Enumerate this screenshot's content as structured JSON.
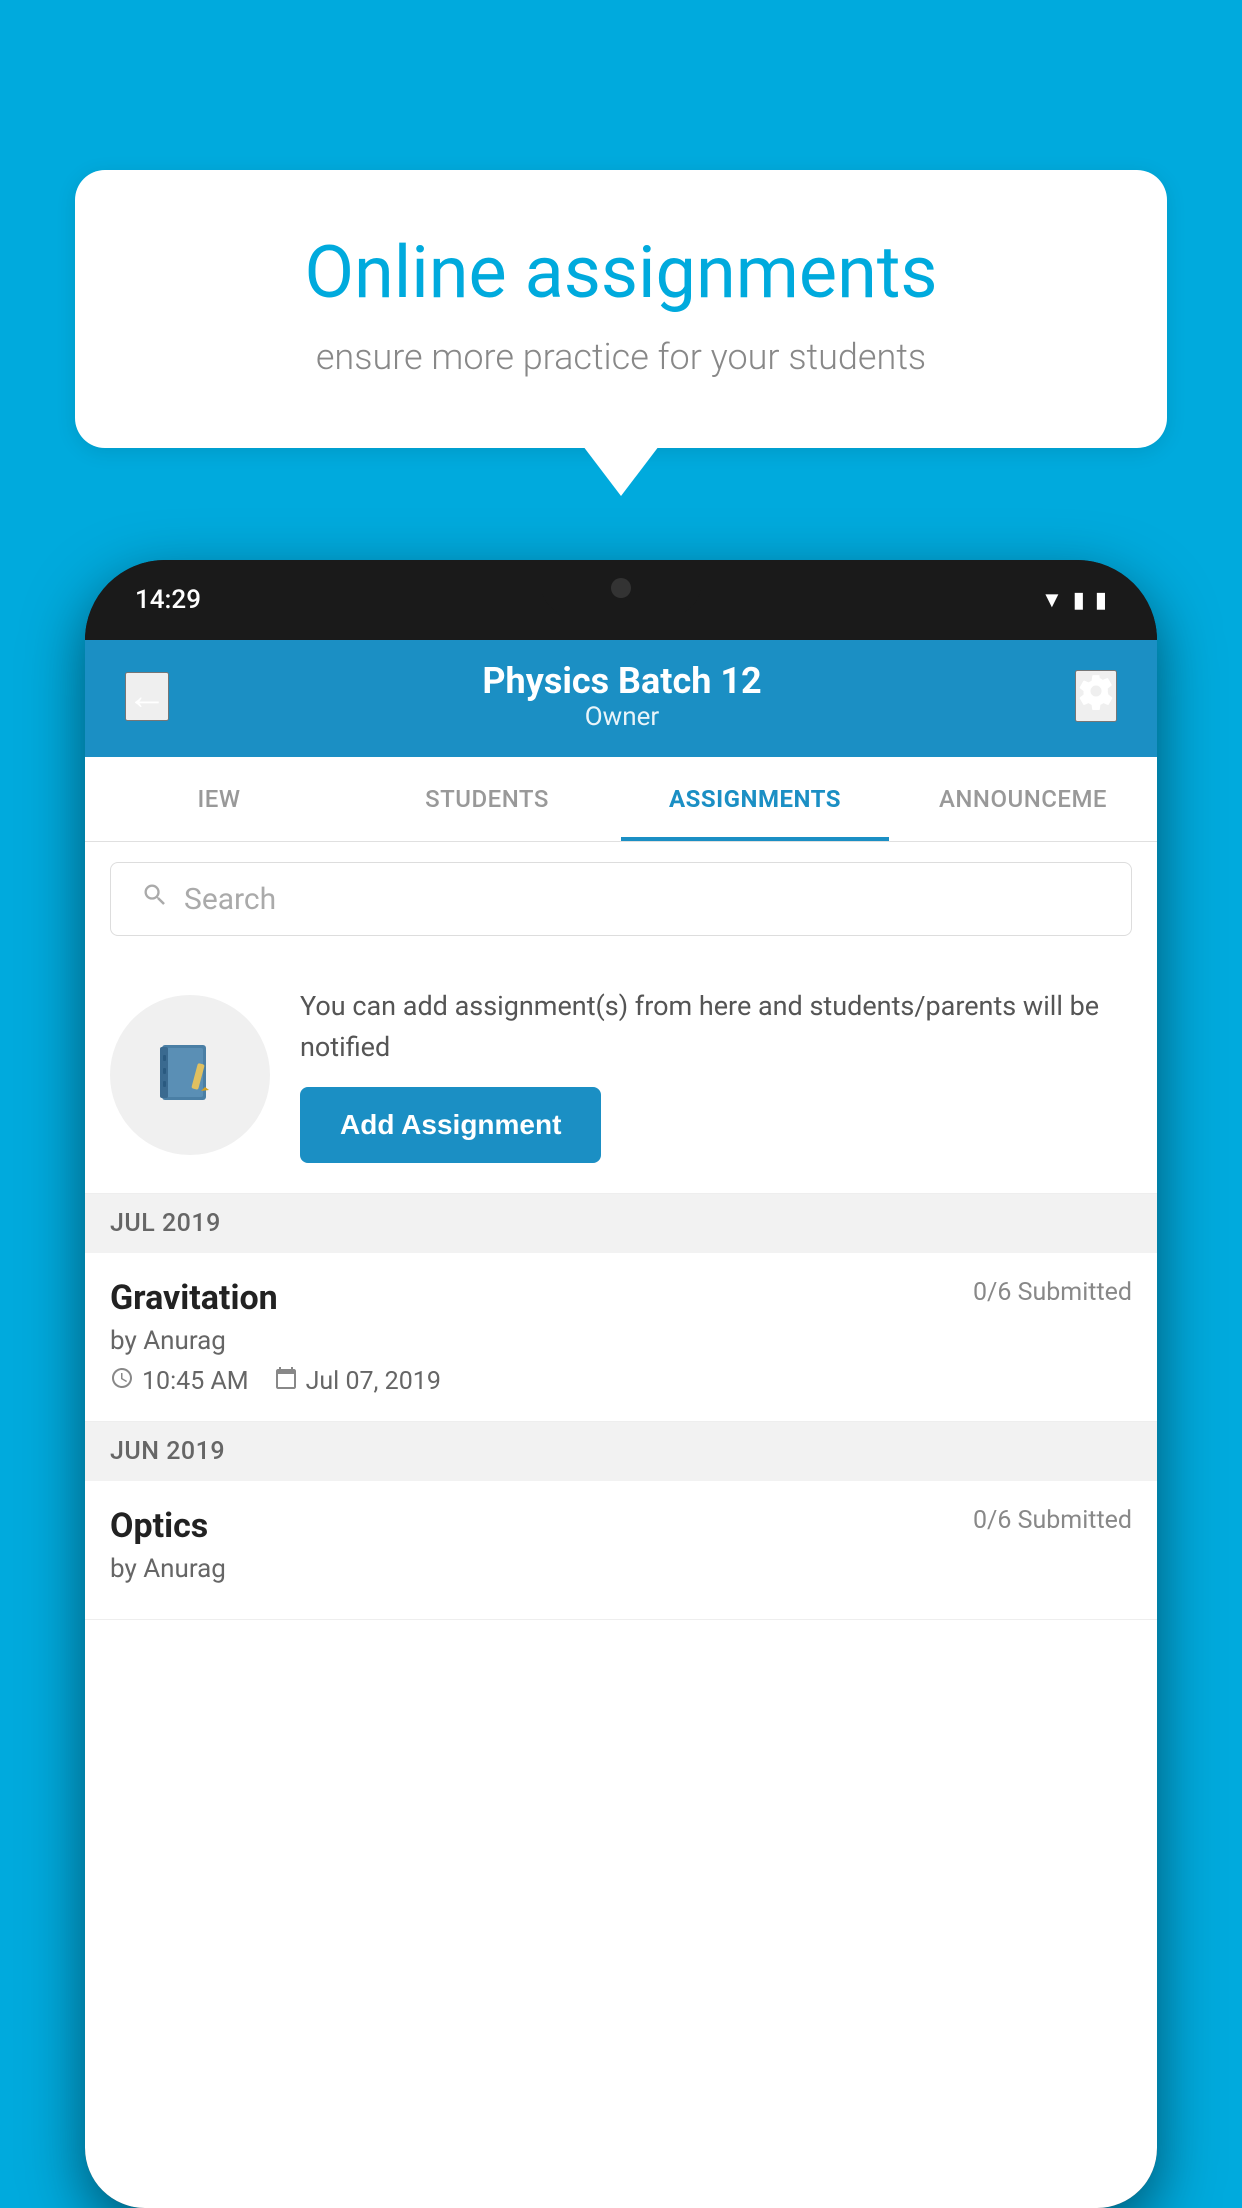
{
  "background_color": "#00AADD",
  "speech_bubble": {
    "title": "Online assignments",
    "subtitle": "ensure more practice for your students"
  },
  "status_bar": {
    "time": "14:29",
    "icons": [
      "▼",
      "◂",
      "▮"
    ]
  },
  "app_header": {
    "title": "Physics Batch 12",
    "subtitle": "Owner",
    "back_label": "←",
    "settings_label": "⚙"
  },
  "tabs": [
    {
      "label": "IEW",
      "active": false
    },
    {
      "label": "STUDENTS",
      "active": false
    },
    {
      "label": "ASSIGNMENTS",
      "active": true
    },
    {
      "label": "ANNOUNCEME",
      "active": false
    }
  ],
  "search": {
    "placeholder": "Search"
  },
  "promo": {
    "text": "You can add assignment(s) from here and students/parents will be notified",
    "button_label": "Add Assignment"
  },
  "sections": [
    {
      "header": "JUL 2019",
      "assignments": [
        {
          "name": "Gravitation",
          "submitted": "0/6 Submitted",
          "author": "by Anurag",
          "time": "10:45 AM",
          "date": "Jul 07, 2019"
        }
      ]
    },
    {
      "header": "JUN 2019",
      "assignments": [
        {
          "name": "Optics",
          "submitted": "0/6 Submitted",
          "author": "by Anurag",
          "time": "",
          "date": ""
        }
      ]
    }
  ]
}
